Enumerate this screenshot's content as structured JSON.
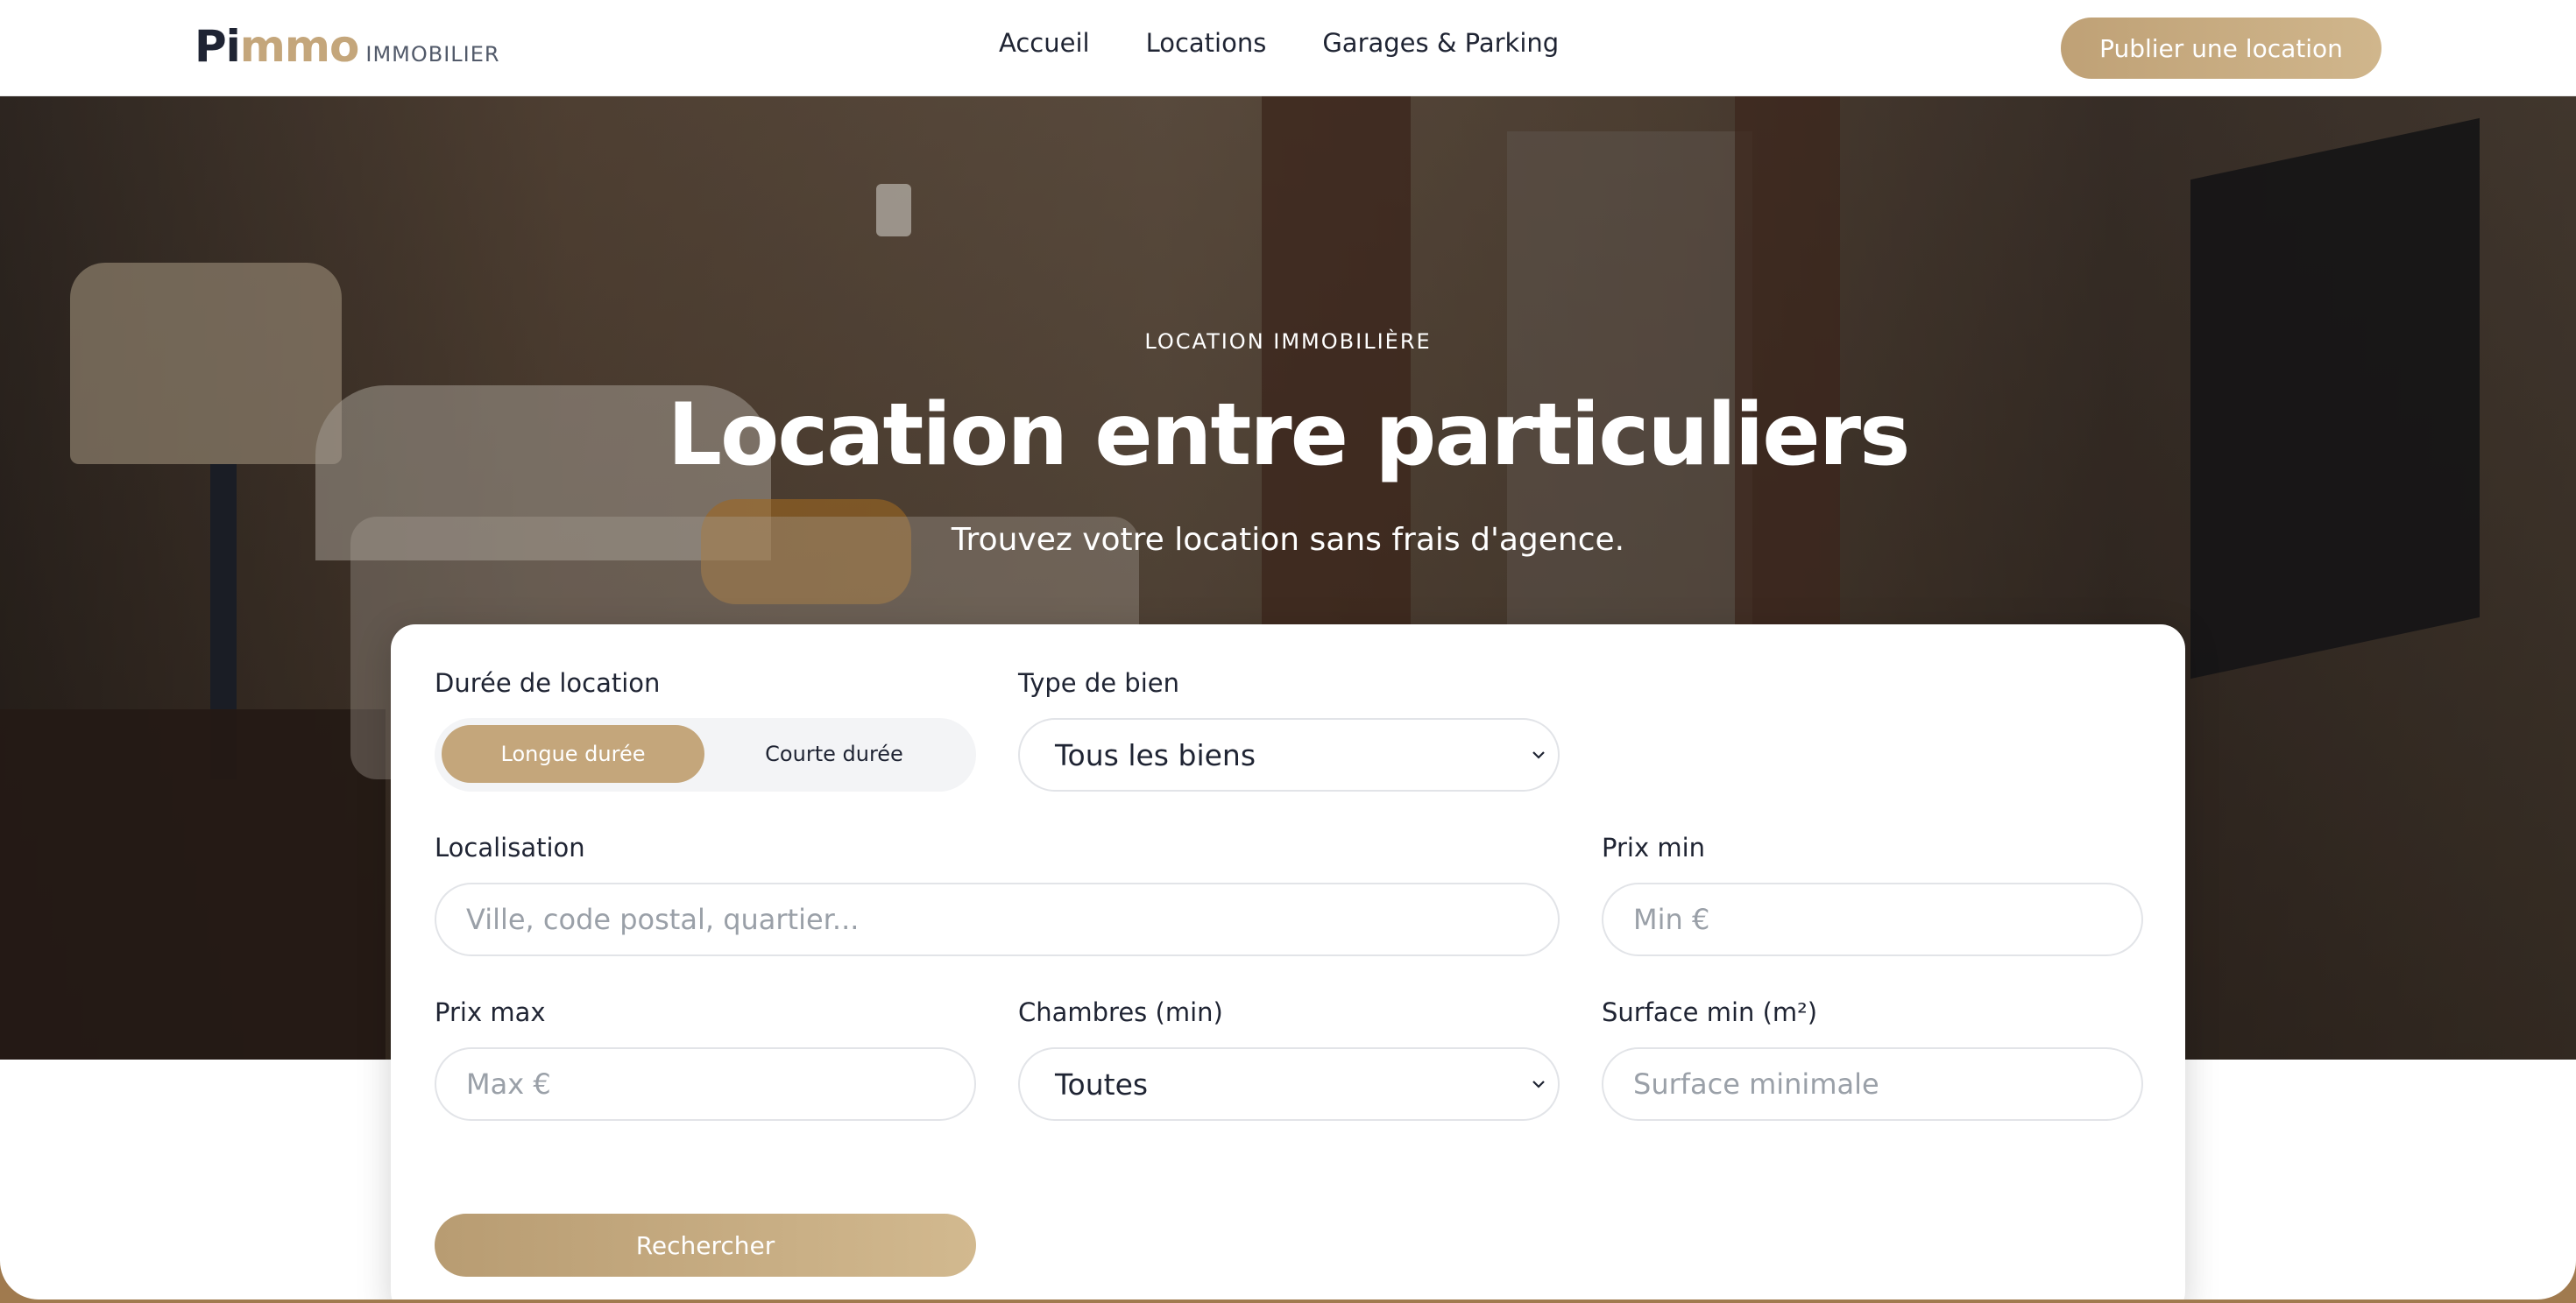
{
  "brand": {
    "logo_main_dark": "Pi",
    "logo_main_accent": "mmo",
    "logo_sub": "IMMOBILIER",
    "accent_color": "#c4a67b",
    "text_color": "#1f2433"
  },
  "nav": {
    "items": [
      {
        "label": "Accueil"
      },
      {
        "label": "Locations"
      },
      {
        "label": "Garages & Parking"
      }
    ],
    "cta_label": "Publier une location"
  },
  "hero": {
    "eyebrow": "LOCATION IMMOBILIÈRE",
    "title": "Location entre particuliers",
    "subtitle": "Trouvez votre location sans frais d'agence."
  },
  "search": {
    "duration": {
      "label": "Durée de location",
      "options": [
        "Longue durée",
        "Courte durée"
      ],
      "selected": "Longue durée"
    },
    "type": {
      "label": "Type de bien",
      "value": "Tous les biens"
    },
    "location": {
      "label": "Localisation",
      "placeholder": "Ville, code postal, quartier..."
    },
    "price_min": {
      "label": "Prix min",
      "placeholder": "Min €"
    },
    "price_max": {
      "label": "Prix max",
      "placeholder": "Max €"
    },
    "bedrooms": {
      "label": "Chambres (min)",
      "value": "Toutes"
    },
    "surface": {
      "label": "Surface min (m²)",
      "placeholder": "Surface minimale"
    },
    "submit_label": "Rechercher"
  }
}
